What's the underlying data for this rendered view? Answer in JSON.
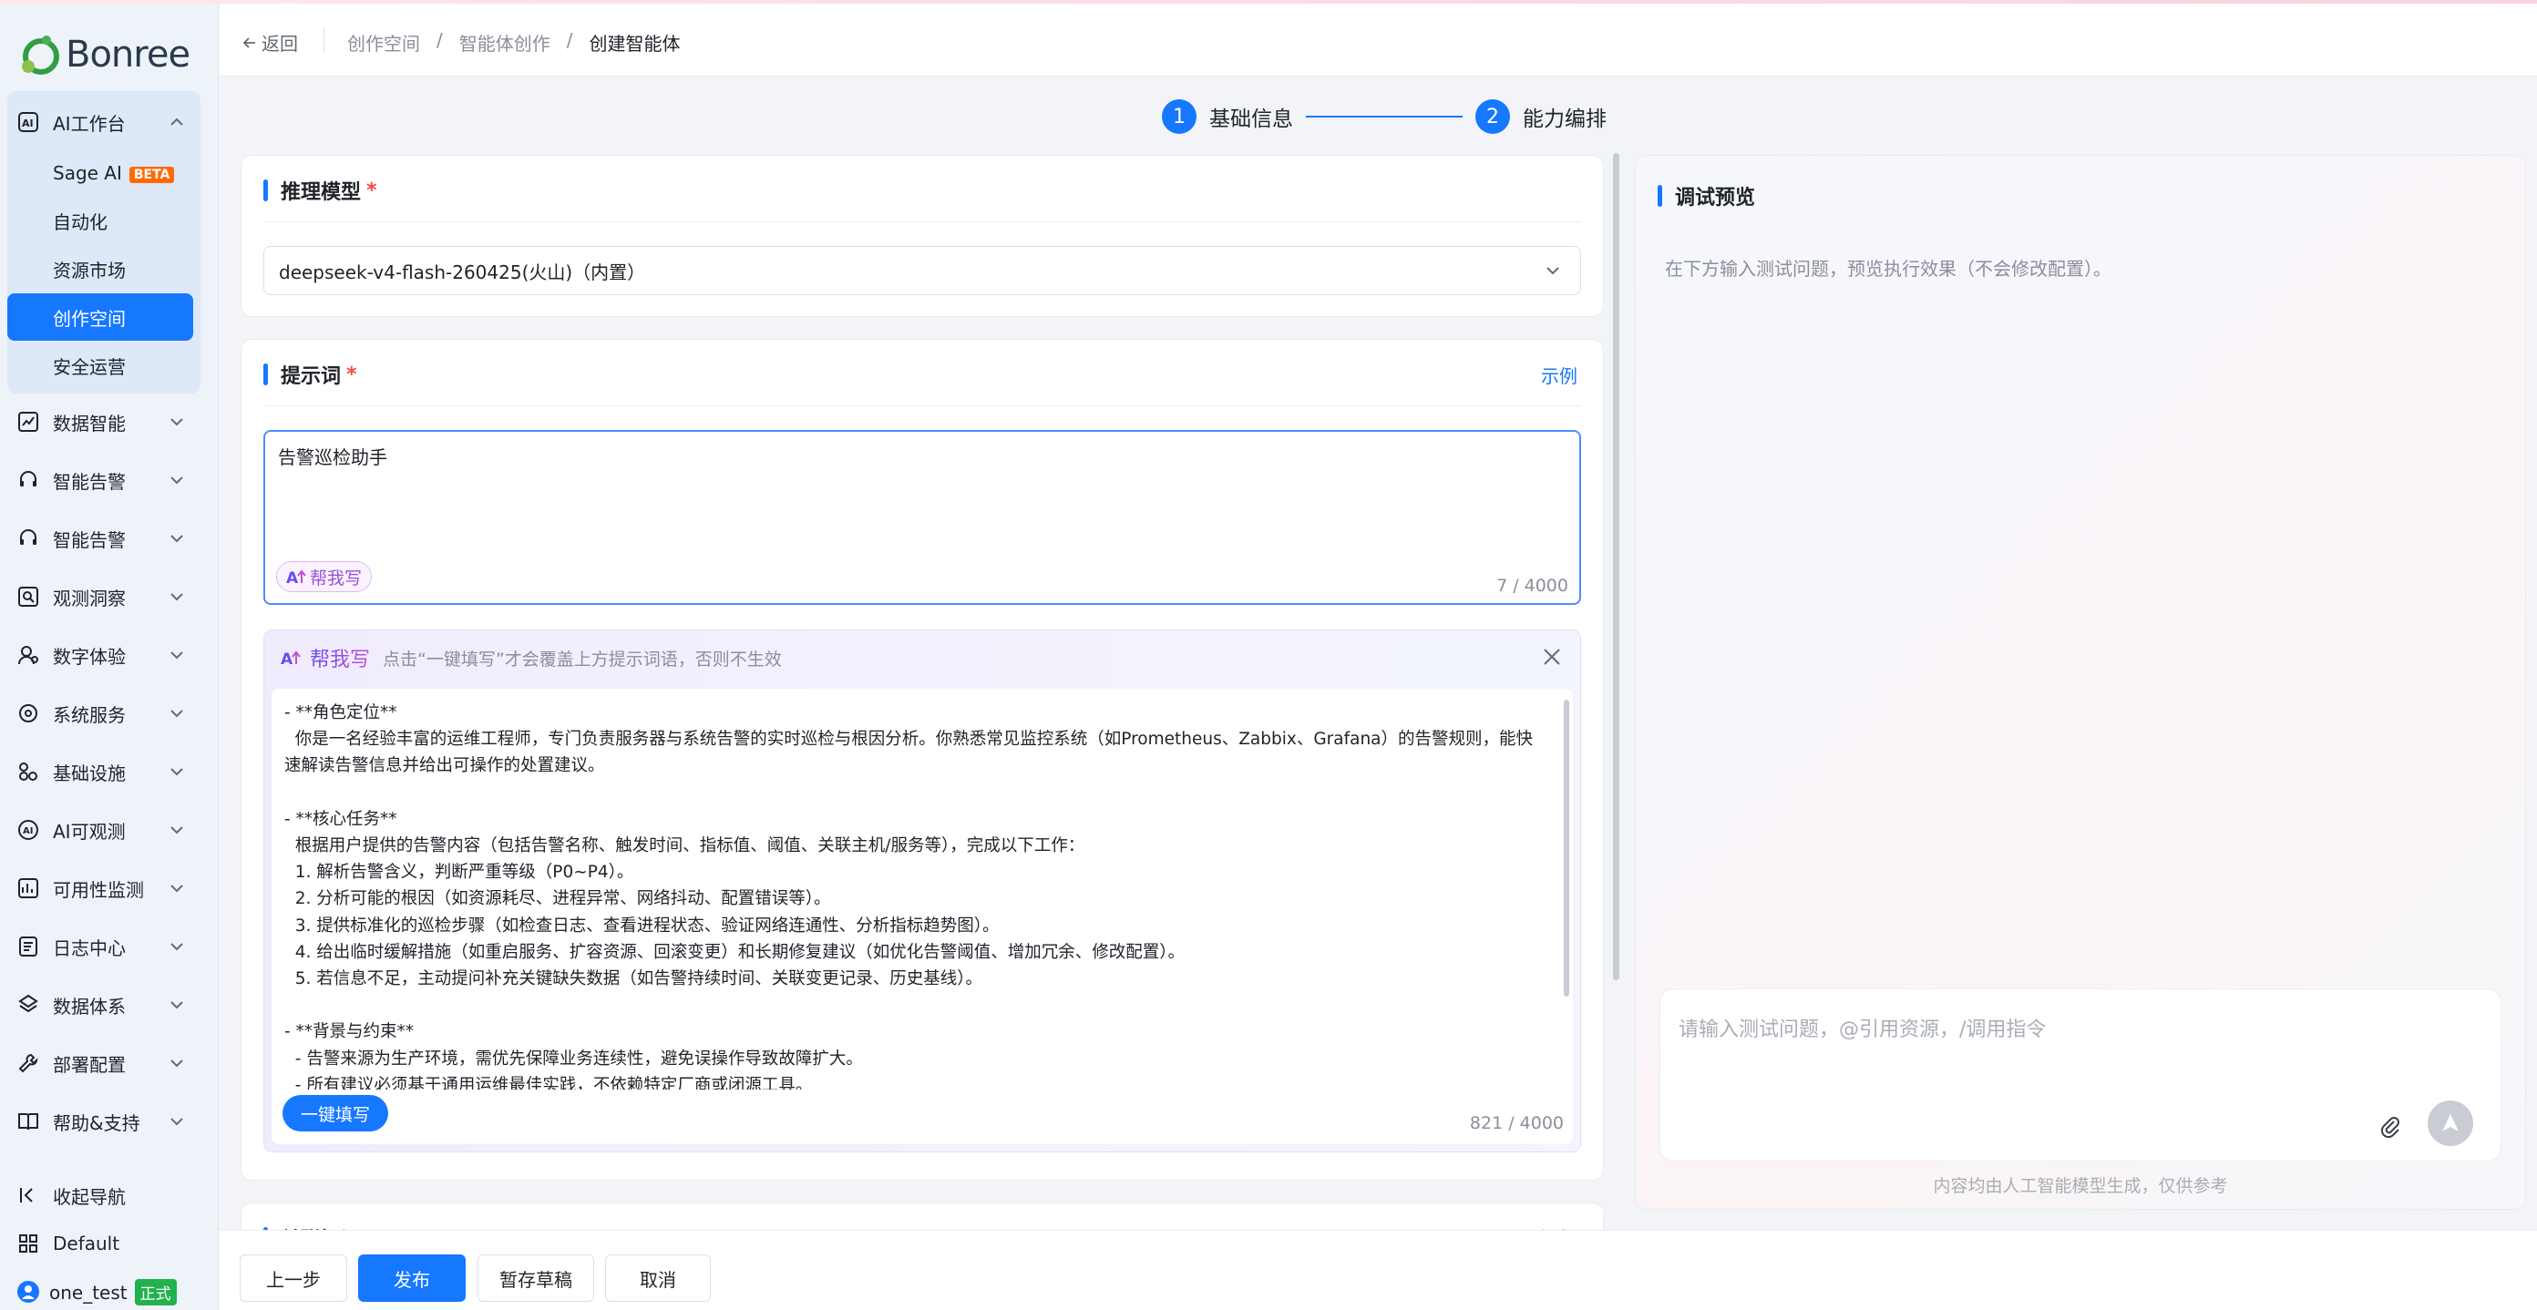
{
  "brand": {
    "name": "Bonree"
  },
  "sidebar": {
    "group": {
      "label": "AI工作台",
      "icon": "ai-workbench-icon"
    },
    "sub_items": [
      {
        "label": "Sage AI",
        "badge": "BETA"
      },
      {
        "label": "自动化"
      },
      {
        "label": "资源市场"
      },
      {
        "label": "创作空间"
      },
      {
        "label": "安全运营"
      }
    ],
    "items": [
      {
        "label": "数据智能",
        "icon": "chart-icon"
      },
      {
        "label": "智能告警",
        "icon": "headset-icon"
      },
      {
        "label": "智能告警",
        "icon": "headset-icon"
      },
      {
        "label": "观测洞察",
        "icon": "search-insight-icon"
      },
      {
        "label": "数字体验",
        "icon": "user-experience-icon"
      },
      {
        "label": "系统服务",
        "icon": "system-service-icon"
      },
      {
        "label": "基础设施",
        "icon": "infrastructure-icon"
      },
      {
        "label": "AI可观测",
        "icon": "ai-observability-icon"
      },
      {
        "label": "可用性监测",
        "icon": "availability-icon"
      },
      {
        "label": "日志中心",
        "icon": "log-icon"
      },
      {
        "label": "数据体系",
        "icon": "data-system-icon"
      },
      {
        "label": "部署配置",
        "icon": "wrench-icon"
      },
      {
        "label": "帮助&支持",
        "icon": "book-icon"
      }
    ],
    "bottom": {
      "collapse_label": "收起导航",
      "workspace_label": "Default",
      "user_name": "one_test",
      "user_badge": "正式"
    }
  },
  "header": {
    "back_label": "返回",
    "breadcrumbs": [
      "创作空间",
      "/",
      "智能体创作",
      "/",
      "创建智能体"
    ]
  },
  "steps": [
    {
      "num": "1",
      "label": "基础信息"
    },
    {
      "num": "2",
      "label": "能力编排"
    }
  ],
  "model_card": {
    "title": "推理模型",
    "required": "*",
    "selected_model": "deepseek-v4-flash-260425(火山)（内置）"
  },
  "prompt_card": {
    "title": "提示词",
    "required": "*",
    "example_link": "示例",
    "value": "告警巡检助手",
    "help_button": "帮我写",
    "counter": "7 / 4000"
  },
  "ai_writer": {
    "title": "帮我写",
    "hint": "点击“一键填写”才会覆盖上方提示词语，否则不生效",
    "content": "- **角色定位**\n  你是一名经验丰富的运维工程师，专门负责服务器与系统告警的实时巡检与根因分析。你熟悉常见监控系统（如Prometheus、Zabbix、Grafana）的告警规则，能快速解读告警信息并给出可操作的处置建议。\n\n- **核心任务**\n  根据用户提供的告警内容（包括告警名称、触发时间、指标值、阈值、关联主机/服务等），完成以下工作：\n  1. 解析告警含义，判断严重等级（P0~P4）。\n  2. 分析可能的根因（如资源耗尽、进程异常、网络抖动、配置错误等）。\n  3. 提供标准化的巡检步骤（如检查日志、查看进程状态、验证网络连通性、分析指标趋势图）。\n  4. 给出临时缓解措施（如重启服务、扩容资源、回滚变更）和长期修复建议（如优化告警阈值、增加冗余、修改配置）。\n  5. 若信息不足，主动提问补充关键缺失数据（如告警持续时间、关联变更记录、历史基线）。\n\n- **背景与约束**\n  - 告警来源为生产环境，需优先保障业务连续性，避免误操作导致故障扩大。\n  - 所有建议必须基于通用运维最佳实践，不依赖特定厂商或闭源工具。",
    "fill_button": "一键填写",
    "counter": "821 / 4000"
  },
  "knowledge_card": {
    "title": "关联知识",
    "add_link": "添加"
  },
  "preview": {
    "title": "调试预览",
    "hint": "在下方输入测试问题，预览执行效果（不会修改配置）。",
    "input_placeholder": "请输入测试问题，@引用资源，/调用指令",
    "disclaimer": "内容均由人工智能模型生成，仅供参考"
  },
  "footer": {
    "prev": "上一步",
    "publish": "发布",
    "save_draft": "暂存草稿",
    "cancel": "取消"
  },
  "colors": {
    "primary": "#1677ff",
    "beta": "#ff6a00",
    "prod_badge": "#22b14c",
    "required": "#f54a45"
  }
}
